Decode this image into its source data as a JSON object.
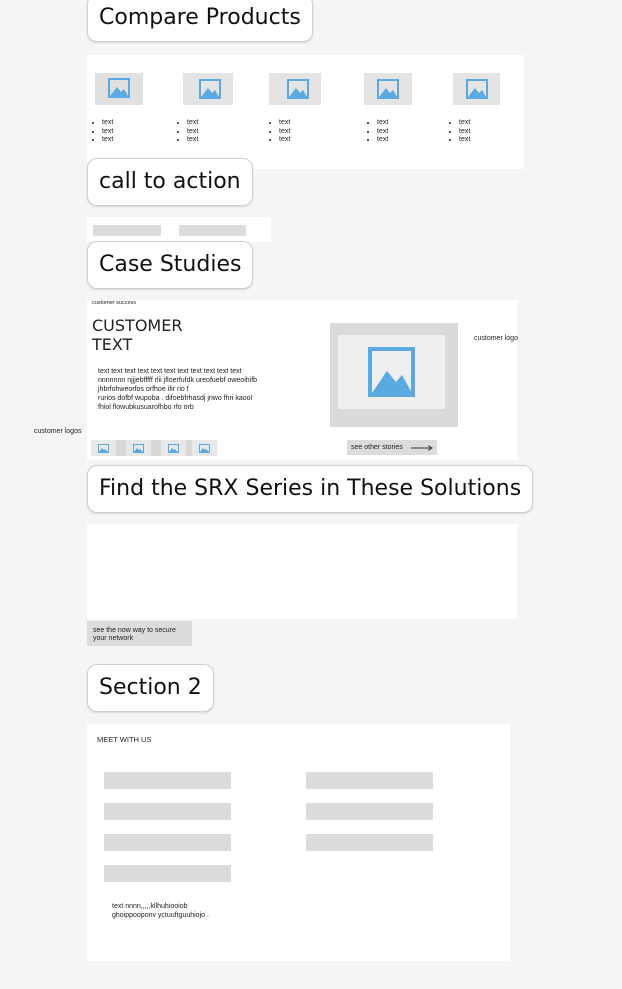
{
  "sections": {
    "compare": "Compare Products",
    "cta": "call to action",
    "case_studies": "Case Studies",
    "find": "Find the SRX Series in These Solutions",
    "section2": "Section 2"
  },
  "compare": {
    "products": [
      {
        "bullets": [
          "text",
          "text",
          "text"
        ]
      },
      {
        "bullets": [
          "text",
          "text",
          "text"
        ]
      },
      {
        "bullets": [
          "text",
          "text",
          "text"
        ]
      },
      {
        "bullets": [
          "text",
          "text",
          "text"
        ]
      },
      {
        "bullets": [
          "text",
          "text",
          "text"
        ]
      }
    ]
  },
  "case": {
    "eyebrow": "customer success",
    "title_line1": "CUSTOMER",
    "title_line2": "TEXT",
    "body_lines": [
      "text text text text text text text text text text text",
      "nnnnnnn njjjebfffff rlii jfloerfufdk ureofuebf oweoihifb",
      "jhbrfohweorfos orfhoe ifir rio f",
      "rurios dofbf wupoba . difoebfrhasdj jriwo fhri kaool",
      "fhiol flowubkusuarofhbo rfo orb"
    ],
    "customer_logo": "customer logo",
    "customer_logos": "customer logos",
    "see_other": "see other stories"
  },
  "find": {
    "cta_line1": "see the now way to secure",
    "cta_line2": "your network"
  },
  "section2": {
    "heading": "MEET WITH US",
    "note_line1": "text nnnn,,,,,kllhuhiooiob",
    "note_line2": "ghoippooponv yctuuftguuhiojo ."
  },
  "colors": {
    "icon_blue": "#5aa9e0",
    "placeholder_gray": "#dcdcdc",
    "page_bg": "#f5f5f5"
  }
}
